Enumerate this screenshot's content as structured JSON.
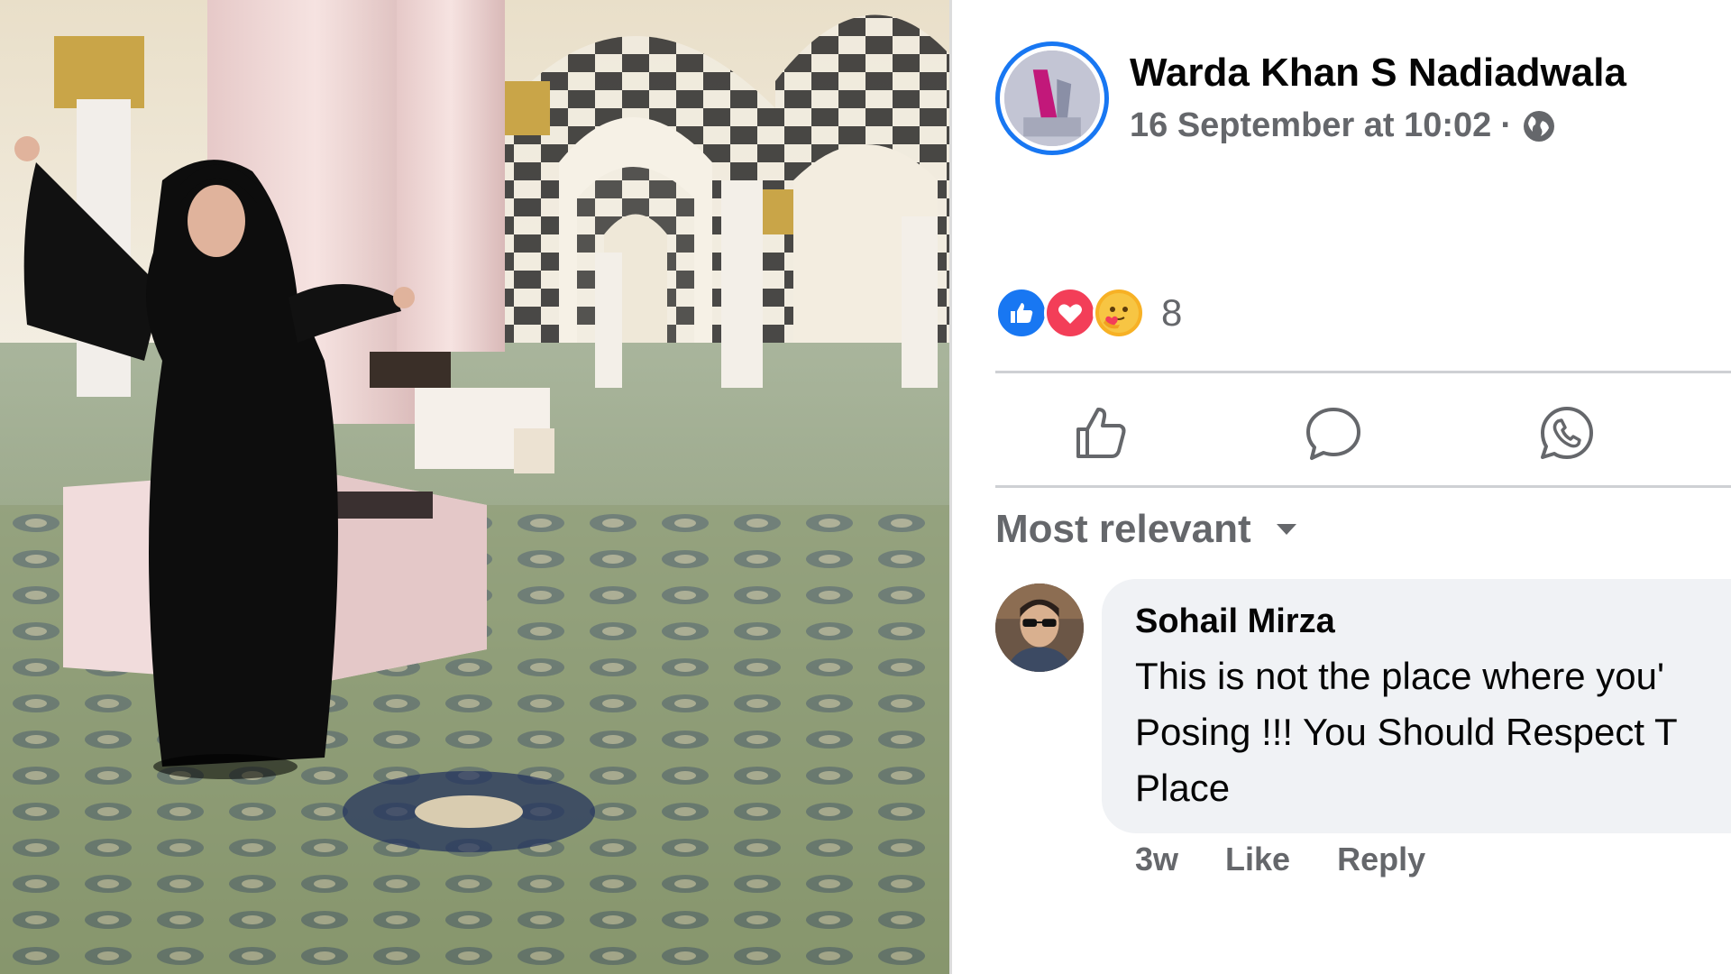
{
  "post": {
    "author_name": "Warda Khan S Nadiadwala",
    "timestamp": "16 September at 10:02",
    "separator": "·",
    "privacy_icon": "globe-icon",
    "reactions": {
      "types": [
        "like",
        "love",
        "care"
      ],
      "count": "8"
    },
    "actions": {
      "like_icon": "thumbs-up-icon",
      "comment_icon": "comment-icon",
      "share_icon": "whatsapp-icon"
    }
  },
  "comments_section": {
    "sort_label": "Most relevant",
    "comments": [
      {
        "author": "Sohail Mirza",
        "text_lines": [
          "This is not the place where you'",
          "Posing !!! You Should Respect T",
          "Place"
        ],
        "age": "3w",
        "like_label": "Like",
        "reply_label": "Reply"
      }
    ]
  },
  "colors": {
    "accent_blue": "#1877f2",
    "love_red": "#f33e58",
    "care_yellow": "#f7b125",
    "secondary_text": "#65676b",
    "bubble_bg": "#f0f2f5"
  }
}
